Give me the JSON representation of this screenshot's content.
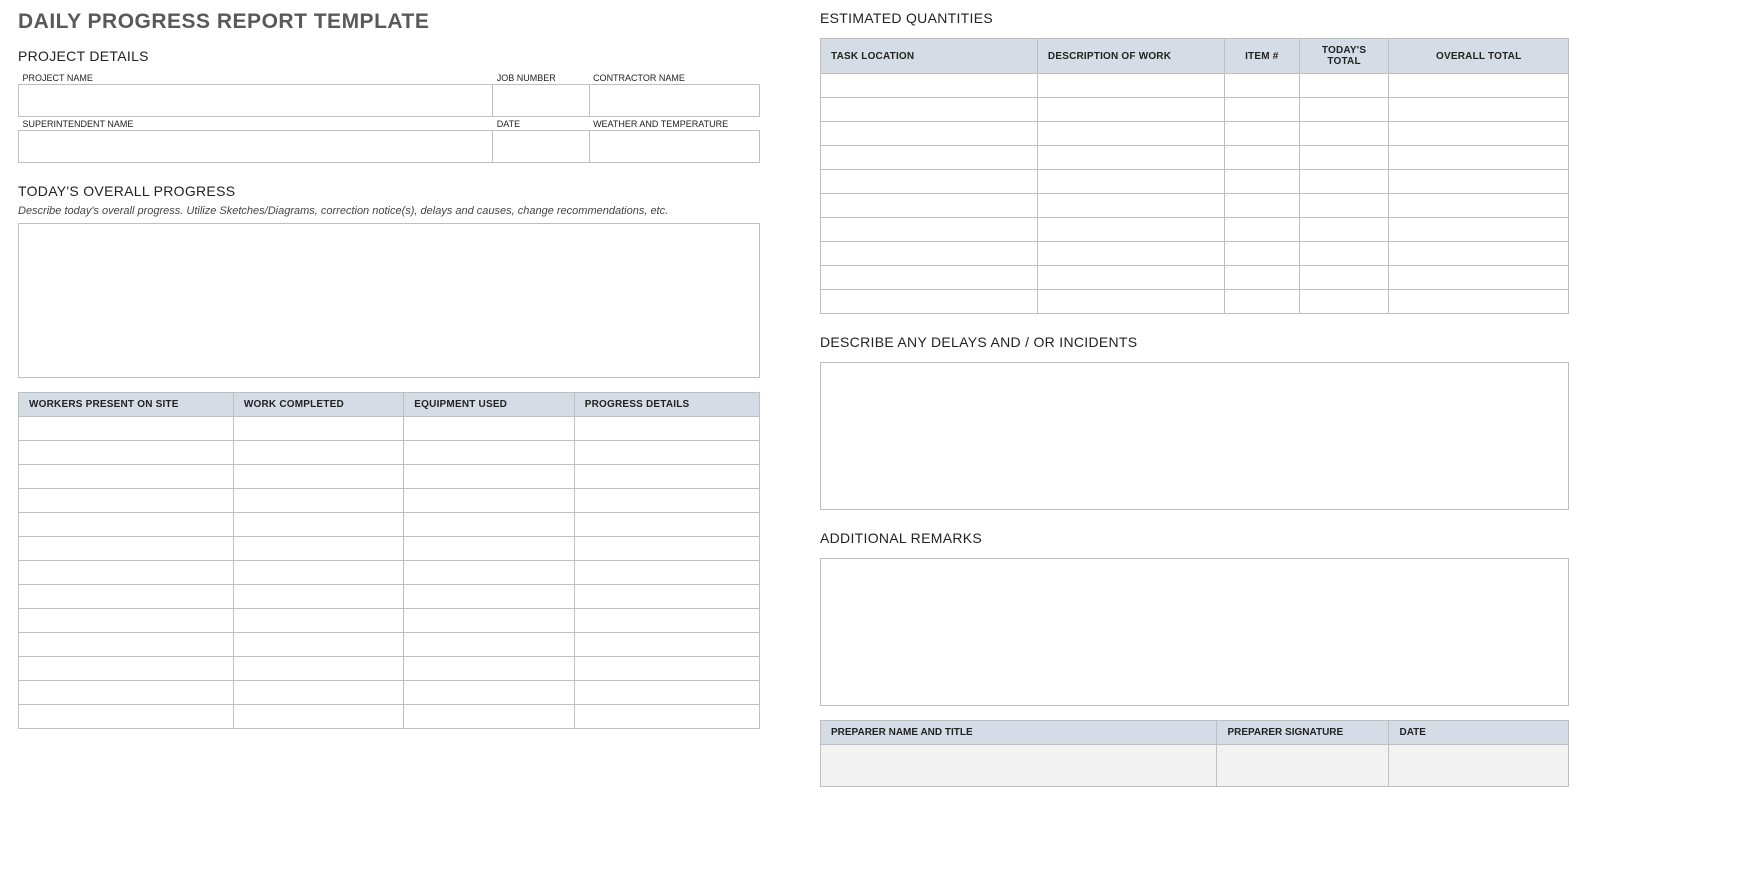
{
  "title": "DAILY PROGRESS REPORT TEMPLATE",
  "left": {
    "project_details_heading": "PROJECT DETAILS",
    "labels": {
      "project_name": "PROJECT NAME",
      "job_number": "JOB NUMBER",
      "contractor_name": "CONTRACTOR NAME",
      "superintendent_name": "SUPERINTENDENT NAME",
      "date": "DATE",
      "weather": "WEATHER AND TEMPERATURE"
    },
    "values": {
      "project_name": "",
      "job_number": "",
      "contractor_name": "",
      "superintendent_name": "",
      "date": "",
      "weather": ""
    },
    "overall_heading": "TODAY'S OVERALL PROGRESS",
    "overall_instruction": "Describe today's overall progress.  Utilize Sketches/Diagrams, correction notice(s), delays and causes, change recommendations, etc.",
    "overall_text": "",
    "progress_headers": {
      "workers": "WORKERS PRESENT ON SITE",
      "completed": "WORK COMPLETED",
      "equipment": "EQUIPMENT USED",
      "details": "PROGRESS DETAILS"
    },
    "progress_rows": [
      {
        "workers": "",
        "completed": "",
        "equipment": "",
        "details": ""
      },
      {
        "workers": "",
        "completed": "",
        "equipment": "",
        "details": ""
      },
      {
        "workers": "",
        "completed": "",
        "equipment": "",
        "details": ""
      },
      {
        "workers": "",
        "completed": "",
        "equipment": "",
        "details": ""
      },
      {
        "workers": "",
        "completed": "",
        "equipment": "",
        "details": ""
      },
      {
        "workers": "",
        "completed": "",
        "equipment": "",
        "details": ""
      },
      {
        "workers": "",
        "completed": "",
        "equipment": "",
        "details": ""
      },
      {
        "workers": "",
        "completed": "",
        "equipment": "",
        "details": ""
      },
      {
        "workers": "",
        "completed": "",
        "equipment": "",
        "details": ""
      },
      {
        "workers": "",
        "completed": "",
        "equipment": "",
        "details": ""
      },
      {
        "workers": "",
        "completed": "",
        "equipment": "",
        "details": ""
      },
      {
        "workers": "",
        "completed": "",
        "equipment": "",
        "details": ""
      },
      {
        "workers": "",
        "completed": "",
        "equipment": "",
        "details": ""
      }
    ]
  },
  "right": {
    "est_heading": "ESTIMATED QUANTITIES",
    "est_headers": {
      "task_location": "TASK LOCATION",
      "description": "DESCRIPTION OF WORK",
      "item": "ITEM #",
      "today_total": "TODAY'S TOTAL",
      "overall_total": "OVERALL TOTAL"
    },
    "est_rows": [
      {
        "task_location": "",
        "description": "",
        "item": "",
        "today_total": "",
        "overall_total": ""
      },
      {
        "task_location": "",
        "description": "",
        "item": "",
        "today_total": "",
        "overall_total": ""
      },
      {
        "task_location": "",
        "description": "",
        "item": "",
        "today_total": "",
        "overall_total": ""
      },
      {
        "task_location": "",
        "description": "",
        "item": "",
        "today_total": "",
        "overall_total": ""
      },
      {
        "task_location": "",
        "description": "",
        "item": "",
        "today_total": "",
        "overall_total": ""
      },
      {
        "task_location": "",
        "description": "",
        "item": "",
        "today_total": "",
        "overall_total": ""
      },
      {
        "task_location": "",
        "description": "",
        "item": "",
        "today_total": "",
        "overall_total": ""
      },
      {
        "task_location": "",
        "description": "",
        "item": "",
        "today_total": "",
        "overall_total": ""
      },
      {
        "task_location": "",
        "description": "",
        "item": "",
        "today_total": "",
        "overall_total": ""
      },
      {
        "task_location": "",
        "description": "",
        "item": "",
        "today_total": "",
        "overall_total": ""
      }
    ],
    "delays_heading": "DESCRIBE ANY DELAYS AND / OR INCIDENTS",
    "delays_text": "",
    "remarks_heading": "ADDITIONAL REMARKS",
    "remarks_text": "",
    "preparer_headers": {
      "name": "PREPARER NAME AND TITLE",
      "signature": "PREPARER SIGNATURE",
      "date": "DATE"
    },
    "preparer_values": {
      "name": "",
      "signature": "",
      "date": ""
    }
  }
}
